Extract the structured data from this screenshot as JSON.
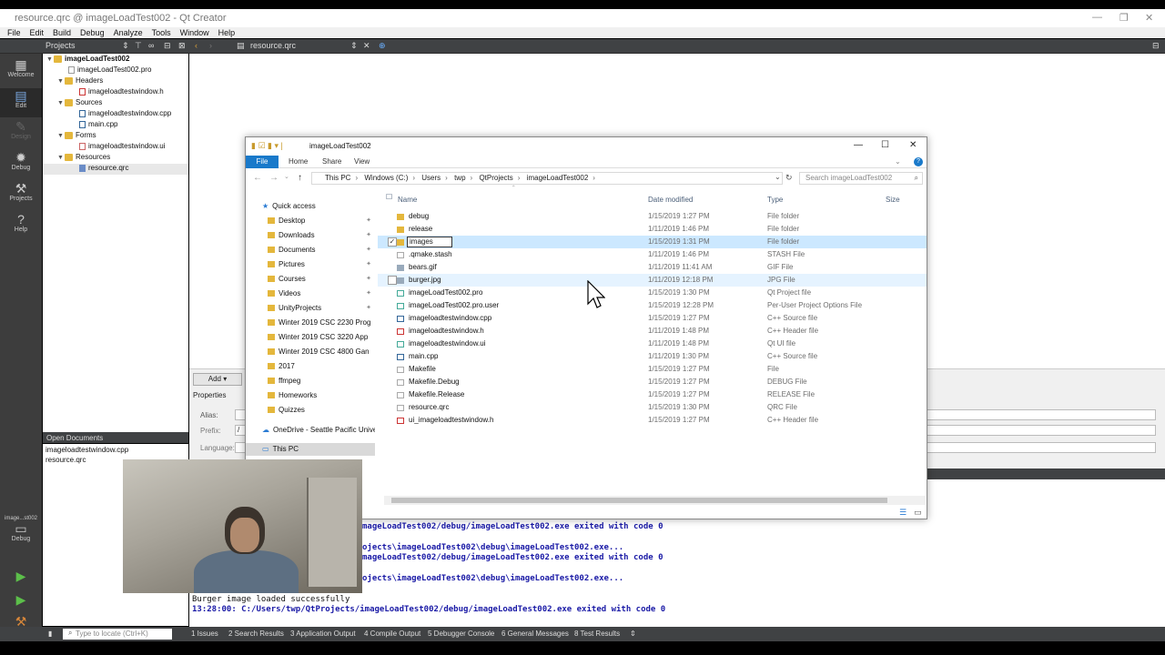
{
  "window": {
    "title": "resource.qrc @ imageLoadTest002 - Qt Creator"
  },
  "menu": [
    "File",
    "Edit",
    "Build",
    "Debug",
    "Analyze",
    "Tools",
    "Window",
    "Help"
  ],
  "toolbar": {
    "projects_label": "Projects",
    "open_file": "resource.qrc"
  },
  "modes": [
    {
      "label": "Welcome",
      "icon": "grid-icon"
    },
    {
      "label": "Edit",
      "icon": "edit-icon"
    },
    {
      "label": "Design",
      "icon": "pencil-icon"
    },
    {
      "label": "Debug",
      "icon": "bug-icon"
    },
    {
      "label": "Projects",
      "icon": "wrench-icon"
    },
    {
      "label": "Help",
      "icon": "help-icon"
    }
  ],
  "kit": {
    "label": "image...st002",
    "mode": "Debug"
  },
  "project_tree": [
    {
      "label": "imageLoadTest002"
    },
    {
      "label": "imageLoadTest002.pro"
    },
    {
      "label": "Headers"
    },
    {
      "label": "imageloadtestwindow.h"
    },
    {
      "label": "Sources"
    },
    {
      "label": "imageloadtestwindow.cpp"
    },
    {
      "label": "main.cpp"
    },
    {
      "label": "Forms"
    },
    {
      "label": "imageloadtestwindow.ui"
    },
    {
      "label": "Resources"
    },
    {
      "label": "resource.qrc"
    }
  ],
  "open_documents": {
    "title": "Open Documents",
    "items": [
      "imageloadtestwindow.cpp",
      "resource.qrc"
    ]
  },
  "resource_editor": {
    "add_label": "Add",
    "properties_label": "Properties",
    "alias_label": "Alias:",
    "prefix_label": "Prefix:",
    "prefix_value": "/",
    "language_label": "Language:"
  },
  "output": [
    "mageLoadTest002/debug/imageLoadTest002.exe exited with code 0",
    "ojects\\imageLoadTest002\\debug\\imageLoadTest002.exe...",
    "mageLoadTest002/debug/imageLoadTest002.exe exited with code 0",
    "ojects\\imageLoadTest002\\debug\\imageLoadTest002.exe...",
    "Burger image loaded successfully",
    "13:28:00: C:/Users/twp/QtProjects/imageLoadTest002/debug/imageLoadTest002.exe exited with code 0"
  ],
  "statusbar": {
    "locator_placeholder": "Type to locate (Ctrl+K)",
    "tabs": [
      "1  Issues",
      "2  Search Results",
      "3  Application Output",
      "4  Compile Output",
      "5  Debugger Console",
      "6  General Messages",
      "8  Test Results"
    ]
  },
  "explorer": {
    "title": "imageLoadTest002",
    "ribbon": {
      "file": "File",
      "tabs": [
        "Home",
        "Share",
        "View"
      ],
      "help": "?"
    },
    "address": [
      "This PC",
      "Windows (C:)",
      "Users",
      "twp",
      "QtProjects",
      "imageLoadTest002"
    ],
    "search_placeholder": "Search imageLoadTest002",
    "nav": {
      "quick_access": "Quick access",
      "items": [
        "Desktop",
        "Downloads",
        "Documents",
        "Pictures",
        "Courses",
        "Videos",
        "UnityProjects",
        "Winter 2019 CSC 2230 Prog",
        "Winter 2019 CSC 3220 App",
        "Winter 2019 CSC 4800 Gan",
        "2017",
        "ffmpeg",
        "Homeworks",
        "Quizzes"
      ],
      "onedrive": "OneDrive - Seattle Pacific Univer",
      "this_pc": "This PC"
    },
    "columns": [
      "Name",
      "Date modified",
      "Type",
      "Size"
    ],
    "files": [
      {
        "name": "debug",
        "date": "1/15/2019 1:27 PM",
        "type": "File folder",
        "icon": "folder"
      },
      {
        "name": "release",
        "date": "1/11/2019 1:46 PM",
        "type": "File folder",
        "icon": "folder"
      },
      {
        "name": "images",
        "date": "1/15/2019 1:31 PM",
        "type": "File folder",
        "icon": "folder"
      },
      {
        "name": ".qmake.stash",
        "date": "1/11/2019 1:46 PM",
        "type": "STASH File",
        "icon": "file"
      },
      {
        "name": "bears.gif",
        "date": "1/11/2019 11:41 AM",
        "type": "GIF File",
        "icon": "img"
      },
      {
        "name": "burger.jpg",
        "date": "1/11/2019 12:18 PM",
        "type": "JPG File",
        "icon": "img"
      },
      {
        "name": "imageLoadTest002.pro",
        "date": "1/15/2019 1:30 PM",
        "type": "Qt Project file",
        "icon": "pro"
      },
      {
        "name": "imageLoadTest002.pro.user",
        "date": "1/15/2019 12:28 PM",
        "type": "Per-User Project Options File",
        "icon": "pro"
      },
      {
        "name": "imageloadtestwindow.cpp",
        "date": "1/15/2019 1:27 PM",
        "type": "C++ Source file",
        "icon": "cpp"
      },
      {
        "name": "imageloadtestwindow.h",
        "date": "1/11/2019 1:48 PM",
        "type": "C++ Header file",
        "icon": "h"
      },
      {
        "name": "imageloadtestwindow.ui",
        "date": "1/11/2019 1:48 PM",
        "type": "Qt UI file",
        "icon": "pro"
      },
      {
        "name": "main.cpp",
        "date": "1/11/2019 1:30 PM",
        "type": "C++ Source file",
        "icon": "cpp"
      },
      {
        "name": "Makefile",
        "date": "1/15/2019 1:27 PM",
        "type": "File",
        "icon": "file"
      },
      {
        "name": "Makefile.Debug",
        "date": "1/15/2019 1:27 PM",
        "type": "DEBUG File",
        "icon": "file"
      },
      {
        "name": "Makefile.Release",
        "date": "1/15/2019 1:27 PM",
        "type": "RELEASE File",
        "icon": "file"
      },
      {
        "name": "resource.qrc",
        "date": "1/15/2019 1:30 PM",
        "type": "QRC File",
        "icon": "file"
      },
      {
        "name": "ui_imageloadtestwindow.h",
        "date": "1/15/2019 1:27 PM",
        "type": "C++ Header file",
        "icon": "h"
      }
    ]
  }
}
